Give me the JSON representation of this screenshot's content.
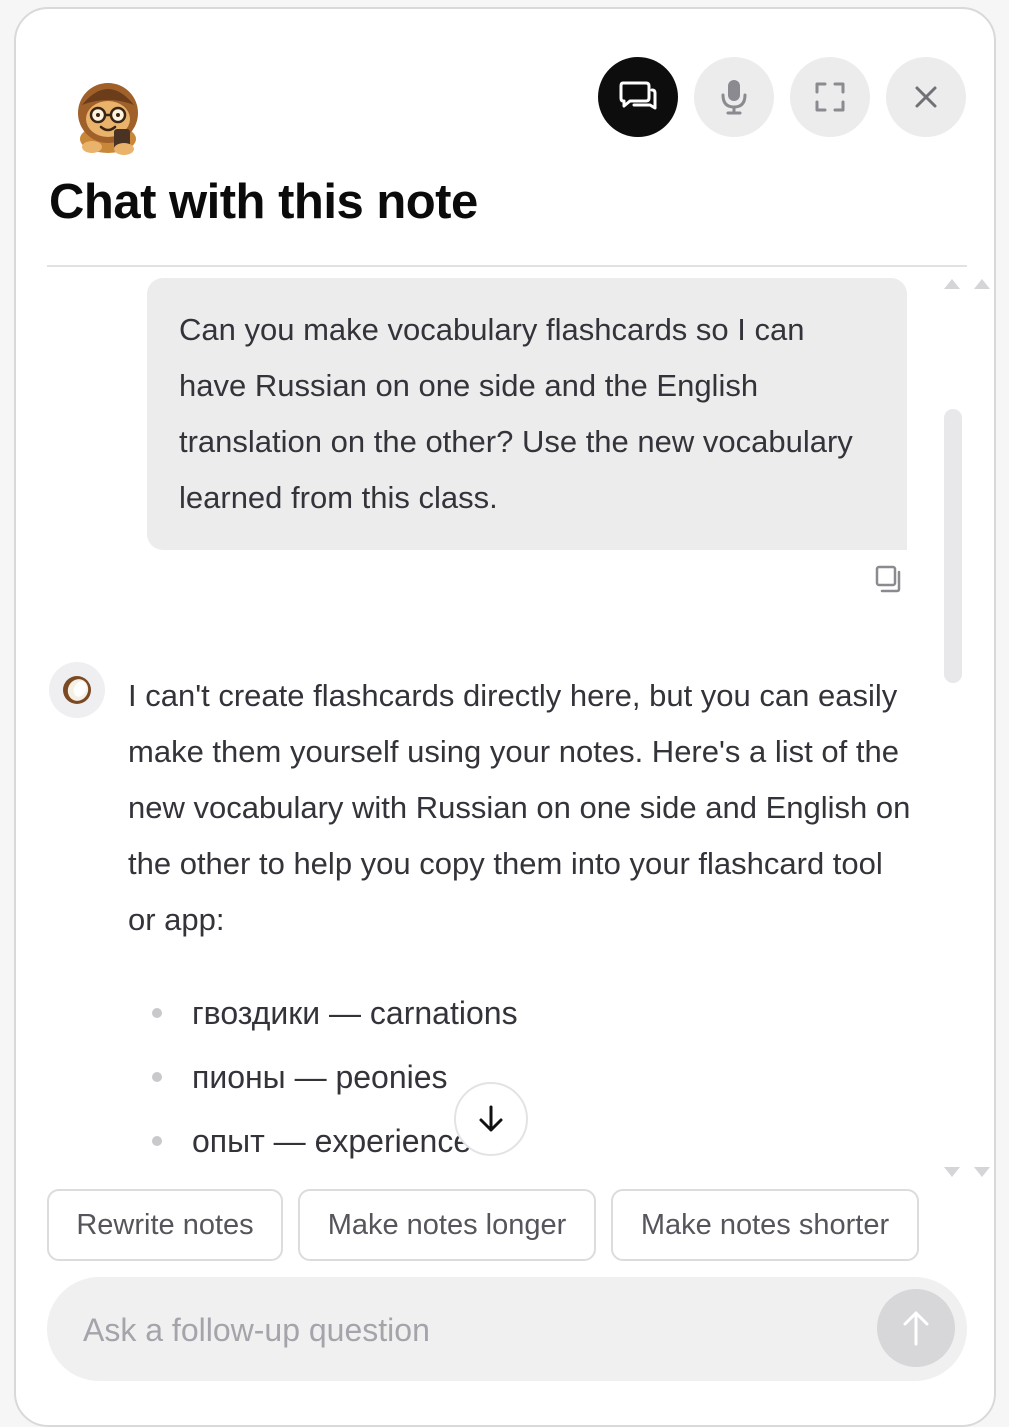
{
  "header": {
    "title": "Chat with this note",
    "actions": [
      {
        "icon": "chat-bubbles-icon",
        "active": true
      },
      {
        "icon": "microphone-icon",
        "active": false
      },
      {
        "icon": "expand-icon",
        "active": false
      },
      {
        "icon": "close-icon",
        "active": false
      }
    ]
  },
  "conversation": {
    "user_message": "Can you make vocabulary flashcards so I can have Russian on one side and the English translation on the other? Use the new vocabulary learned from this class.",
    "assistant_message": "I can't create flashcards directly here, but you can easily make them yourself using your notes. Here's a list of the new vocabulary with Russian on one side and English on the other to help you copy them into your flashcard tool or app:",
    "vocabulary": [
      {
        "text": "гвоздики — carnations"
      },
      {
        "text": "пионы — peonies"
      },
      {
        "text": "опыт — experience"
      }
    ]
  },
  "suggestions": [
    "Rewrite notes",
    "Make notes longer",
    "Make notes shorter"
  ],
  "input": {
    "placeholder": "Ask a follow-up question",
    "value": ""
  },
  "colors": {
    "active_button": "#0d0d0d",
    "button_bg": "#ececed",
    "bubble_bg": "#ececed",
    "send_disabled": "#d7d7da"
  }
}
